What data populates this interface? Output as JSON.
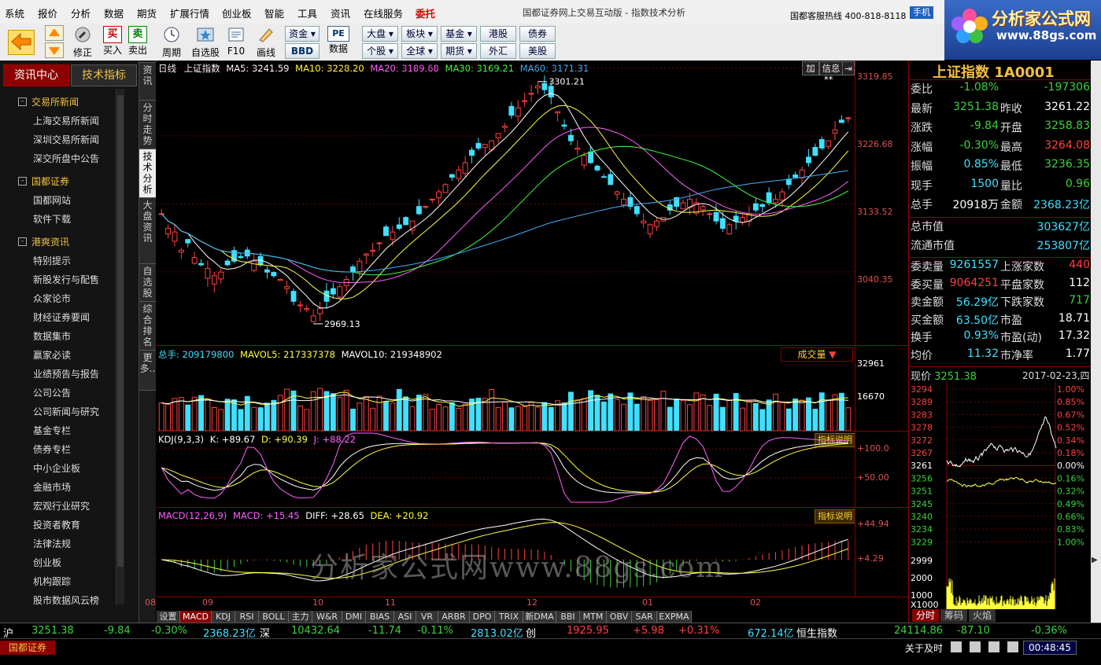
{
  "menubar": {
    "items": [
      "系统",
      "报价",
      "分析",
      "数据",
      "期货",
      "扩展行情",
      "创业板",
      "智能",
      "工具",
      "资讯",
      "在线服务",
      "委托"
    ],
    "title": "国都证券网上交易互动版 - 指数技术分析",
    "hotline": "国都客服热线 400-818-8118",
    "mobile": "手机"
  },
  "logo": {
    "line1": "分析家公式网",
    "line2": "www.88gs.com"
  },
  "toolbar": {
    "buttons": [
      {
        "label": "",
        "icon": "back-arrow-icon"
      },
      {
        "label": "修正",
        "icon": "wrench-icon"
      },
      {
        "label": "买入",
        "icon": "buy-icon",
        "glyph": "买"
      },
      {
        "label": "卖出",
        "icon": "sell-icon",
        "glyph": "卖"
      },
      {
        "label": "周期",
        "icon": "clock-icon"
      },
      {
        "label": "自选股",
        "icon": "star-icon"
      },
      {
        "label": "F10",
        "icon": "f10-icon"
      },
      {
        "label": "画线",
        "icon": "pencil-icon"
      },
      {
        "label": "数据",
        "icon": "pe-icon"
      }
    ],
    "zijin": "资金",
    "bbd": "BBD",
    "pe": "PE",
    "market_btns": [
      [
        "大盘",
        "板块",
        "基金",
        "港股",
        "债券"
      ],
      [
        "个股",
        "全球",
        "期货",
        "外汇",
        "美股"
      ]
    ]
  },
  "leftpanel": {
    "tab_active": "资讯中心",
    "tab_other": "技术指标",
    "sections": [
      {
        "title": "交易所新闻",
        "items": [
          "上海交易所新闻",
          "深圳交易所新闻",
          "深交所盘中公告"
        ]
      },
      {
        "title": "国都证券",
        "items": [
          "国都网站",
          "软件下载"
        ]
      },
      {
        "title": "港爽资讯",
        "items": [
          "特别提示",
          "新股发行与配售",
          "众家论市",
          "财经证券要闻",
          "数据集市",
          "赢家必读",
          "业绩预告与报告",
          "公司公告",
          "公司新闻与研究",
          "基金专栏",
          "债券专栏",
          "中小企业板",
          "金融市场",
          "宏观行业研究",
          "投资者教育",
          "法律法规",
          "创业板",
          "机构跟踪",
          "股市数据风云榜"
        ]
      }
    ]
  },
  "sidetabs": [
    "资讯",
    "分时走势",
    "技术分析",
    "大盘资讯",
    "自选股",
    "综合排名",
    "更多.."
  ],
  "chart": {
    "main_legend": {
      "period": "日线",
      "name": "上证指数",
      "ma5": "MA5: 3241.59",
      "ma10": "MA10: 3228.20",
      "ma20": "MA20: 3189.68",
      "ma30": "MA30: 3169.21",
      "ma60": "MA60: 3171.31"
    },
    "btn_add": "加",
    "btn_info": "信息",
    "stars": "**",
    "main_axis": [
      "3319.85",
      "3226.68",
      "3133.52",
      "3040.35"
    ],
    "high_label": "3301.21",
    "low_label": "2969.13",
    "vol_legend": {
      "total": "总手: 209179800",
      "mavol5": "MAVOL5: 217337378",
      "mavol10": "MAVOL10: 219348902"
    },
    "vol_select": "成交量",
    "vol_axis": [
      "32961",
      "16670"
    ],
    "kdj_legend": {
      "name": "KDJ(9,3,3)",
      "k": "K: +89.67",
      "d": "D: +90.39",
      "j": "J: +88.22"
    },
    "kdj_axis": [
      "+100.0",
      "+50.00"
    ],
    "macd_legend": {
      "name": "MACD(12,26,9)",
      "macd": "MACD: +15.45",
      "diff": "DIFF: +28.65",
      "dea": "DEA: +20.92"
    },
    "macd_axis": [
      "+44.94",
      "+4.29"
    ],
    "indicator_btn": "指标说明",
    "x_labels": [
      "08",
      "09",
      "10",
      "11",
      "12",
      "01",
      "02"
    ],
    "bottom_tabs": [
      "设置",
      "MACD",
      "KDJ",
      "RSI",
      "BOLL",
      "主力",
      "W&R",
      "DMI",
      "BIAS",
      "ASI",
      "VR",
      "ARBR",
      "DPO",
      "TRIX",
      "新DMA",
      "BBI",
      "MTM",
      "OBV",
      "SAR",
      "EXPMA"
    ],
    "watermark": "分析家公式网www.88gs.com"
  },
  "chart_data": {
    "type": "candlestick",
    "title": "上证指数",
    "ylim": [
      2969.13,
      3319.85
    ],
    "high": 3301.21,
    "low": 2969.13,
    "last_close": 3251.38,
    "x_labels": [
      "08",
      "09",
      "10",
      "11",
      "12",
      "01",
      "02"
    ],
    "close_approx": [
      3120,
      3100,
      3095,
      3070,
      3080,
      3060,
      3050,
      3045,
      3035,
      3040,
      3050,
      3055,
      3060,
      3062,
      3055,
      3050,
      3040,
      3035,
      3030,
      3020,
      3000,
      2995,
      2990,
      2980,
      2990,
      3000,
      3010,
      3020,
      3030,
      3040,
      3055,
      3065,
      3070,
      3080,
      3090,
      3095,
      3100,
      3105,
      3110,
      3120,
      3130,
      3140,
      3150,
      3160,
      3170,
      3180,
      3190,
      3200,
      3210,
      3215,
      3220,
      3230,
      3240,
      3255,
      3265,
      3275,
      3285,
      3295,
      3290,
      3280,
      3260,
      3240,
      3220,
      3210,
      3200,
      3190,
      3180,
      3170,
      3160,
      3150,
      3140,
      3130,
      3120,
      3110,
      3105,
      3110,
      3115,
      3125,
      3130,
      3135,
      3140,
      3135,
      3130,
      3120,
      3110,
      3100,
      3105,
      3110,
      3115,
      3120,
      3125,
      3130,
      3135,
      3140,
      3150,
      3160,
      3170,
      3180,
      3190,
      3200,
      3210,
      3220,
      3235,
      3245,
      3251.38
    ]
  },
  "rightpanel": {
    "title": "上证指数 1A0001",
    "rows": [
      {
        "k1": "委比",
        "v1": "-1.08%",
        "c1": "green",
        "k2": "",
        "v2": "-197306",
        "c2": "green"
      },
      {
        "k1": "最新",
        "v1": "3251.38",
        "c1": "green",
        "k2": "昨收",
        "v2": "3261.22",
        "c2": "white"
      },
      {
        "k1": "涨跌",
        "v1": "-9.84",
        "c1": "green",
        "k2": "开盘",
        "v2": "3258.83",
        "c2": "green"
      },
      {
        "k1": "涨幅",
        "v1": "-0.30%",
        "c1": "green",
        "k2": "最高",
        "v2": "3264.08",
        "c2": "red"
      },
      {
        "k1": "振幅",
        "v1": "0.85%",
        "c1": "cyan",
        "k2": "最低",
        "v2": "3236.35",
        "c2": "green"
      },
      {
        "k1": "现手",
        "v1": "1500",
        "c1": "cyan",
        "k2": "量比",
        "v2": "0.96",
        "c2": "green"
      },
      {
        "k1": "总手",
        "v1": "20918万",
        "c1": "white",
        "k2": "金额",
        "v2": "2368.23亿",
        "c2": "cyan"
      }
    ],
    "mktcap": {
      "k": "总市值",
      "v": "303627亿"
    },
    "float": {
      "k": "流通市值",
      "v": "253807亿"
    },
    "rows2": [
      {
        "k1": "委卖量",
        "v1": "9261557",
        "c1": "cyan",
        "k2": "上涨家数",
        "v2": "440",
        "c2": "red"
      },
      {
        "k1": "委买量",
        "v1": "9064251",
        "c1": "red",
        "k2": "平盘家数",
        "v2": "112",
        "c2": "white"
      },
      {
        "k1": "卖金额",
        "v1": "56.29亿",
        "c1": "cyan",
        "k2": "下跌家数",
        "v2": "717",
        "c2": "green"
      },
      {
        "k1": "买金额",
        "v1": "63.50亿",
        "c1": "cyan",
        "k2": "市盈",
        "v2": "18.71",
        "c2": "white"
      },
      {
        "k1": "换手",
        "v1": "0.93%",
        "c1": "cyan",
        "k2": "市盈(动)",
        "v2": "17.32",
        "c2": "white"
      },
      {
        "k1": "均价",
        "v1": "11.32",
        "c1": "cyan",
        "k2": "市净率",
        "v2": "1.77",
        "c2": "white"
      }
    ],
    "mini": {
      "price_label": "现价",
      "price": "3251.38",
      "date": "2017-02-23,四",
      "left_axis": [
        "3294",
        "3289",
        "3283",
        "3278",
        "3272",
        "3267",
        "3261",
        "3256",
        "3251",
        "3245",
        "3240",
        "3234",
        "3229"
      ],
      "right_axis": [
        "1.00%",
        "0.85%",
        "0.67%",
        "0.52%",
        "0.34%",
        "0.18%",
        "0.00%",
        "0.16%",
        "0.32%",
        "0.49%",
        "0.66%",
        "0.83%",
        "1.00%"
      ],
      "vol_axis": [
        "2999",
        "2000",
        "1000",
        "X1000"
      ],
      "tabs": [
        "分时",
        "筹码",
        "火焰"
      ]
    }
  },
  "statusbar": {
    "sh_label": "沪",
    "sh_price": "3251.38",
    "sh_chg": "-9.84",
    "sh_pct": "-0.30%",
    "sh_amt": "2368.23亿",
    "sz_label": "深",
    "sz_price": "10432.64",
    "sz_chg": "-11.74",
    "sz_pct": "-0.11%",
    "sz_amt": "2813.02亿",
    "cy_label": "创",
    "cy_price": "1925.95",
    "cy_chg": "+5.98",
    "cy_pct": "+0.31%",
    "cy_amt": "672.14亿",
    "hs_label": "恒生指数",
    "hs_price": "24114.86",
    "hs_chg": "-87.10",
    "hs_pct": "-0.36%"
  },
  "bottombar": {
    "broker": "国都证券",
    "about": "关于及时",
    "clock": "00:48:45"
  },
  "colors": {
    "up": "#ff4040",
    "down": "#40e0ff",
    "ma5": "#ffffff",
    "ma10": "#ffff40",
    "ma20": "#ff60ff",
    "ma30": "#40ff40",
    "ma60": "#40b0ff"
  }
}
